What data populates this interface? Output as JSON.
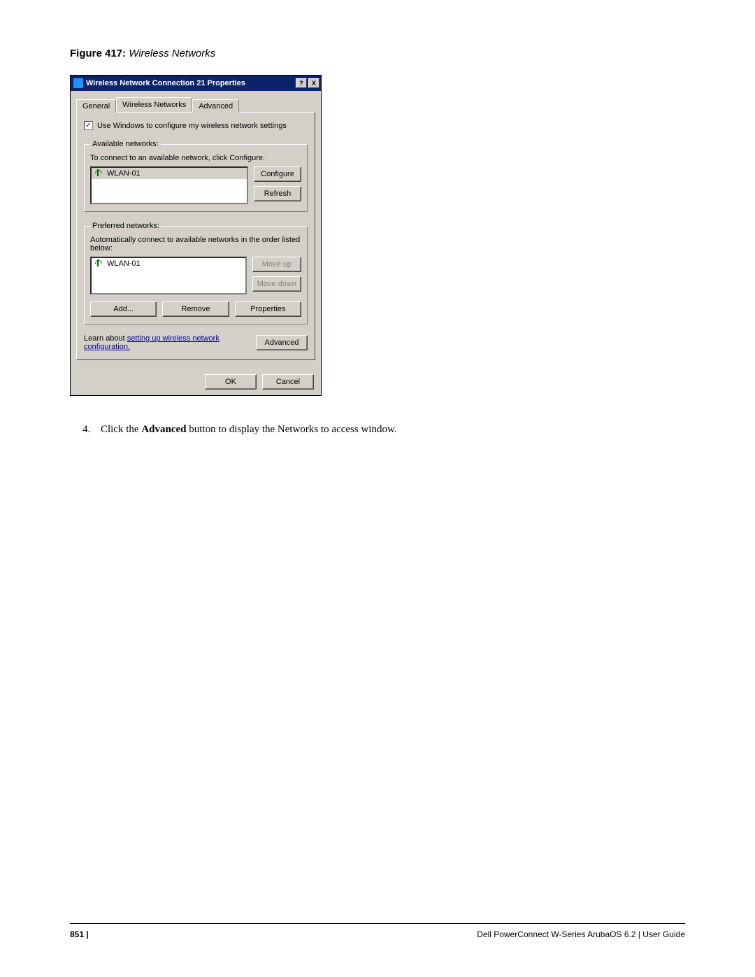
{
  "figure": {
    "label": "Figure 417:",
    "title": "Wireless Networks"
  },
  "dialog": {
    "title": "Wireless Network Connection 21 Properties",
    "help_btn": "?",
    "close_btn": "X",
    "tabs": {
      "general": "General",
      "wireless": "Wireless Networks",
      "advanced": "Advanced"
    },
    "use_windows_check": {
      "checked": "✓",
      "label": "Use Windows to configure my wireless network settings"
    },
    "available": {
      "legend": "Available networks:",
      "hint": "To connect to an available network, click Configure.",
      "items": [
        {
          "name": "WLAN-01"
        }
      ],
      "configure_btn": "Configure",
      "refresh_btn": "Refresh"
    },
    "preferred": {
      "legend": "Preferred networks:",
      "hint": "Automatically connect to available networks in the order listed below:",
      "items": [
        {
          "name": "WLAN-01"
        }
      ],
      "moveup_btn": "Move up",
      "movedown_btn": "Move down",
      "add_btn": "Add...",
      "remove_btn": "Remove",
      "properties_btn": "Properties"
    },
    "learn": {
      "prefix": "Learn about ",
      "link": "setting up wireless network configuration.",
      "advanced_btn": "Advanced"
    },
    "ok_btn": "OK",
    "cancel_btn": "Cancel"
  },
  "step": {
    "num": "4.",
    "before": "Click the ",
    "bold": "Advanced",
    "after": " button to display the Networks to access window."
  },
  "footer": {
    "page": "851",
    "pipe": " | ",
    "doc": "Dell PowerConnect W-Series ArubaOS 6.2",
    "sep": "  |  ",
    "kind": "User Guide"
  }
}
